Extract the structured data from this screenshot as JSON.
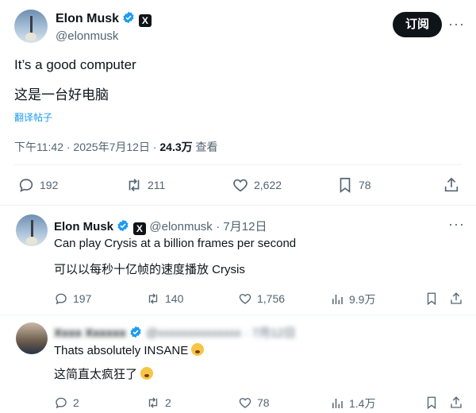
{
  "main_post": {
    "author_name": "Elon Musk",
    "author_handle": "@elonmusk",
    "x_badge": "X",
    "subscribe_label": "订阅",
    "more_label": "···",
    "text_en": "It’s a good computer",
    "text_zh": "这是一台好电脑",
    "translate_label": "翻译帖子",
    "time": "下午11:42 · 2025年7月12日 · ",
    "views": "24.3万",
    "views_label": " 查看",
    "stats": {
      "replies": "192",
      "reposts": "211",
      "likes": "2,622",
      "bookmarks": "78"
    }
  },
  "reply1": {
    "author_name": "Elon Musk",
    "author_handle": "@elonmusk",
    "date": "· 7月12日",
    "more_label": "···",
    "text_en": "Can play Crysis at a billion frames per second",
    "text_zh": "可以以每秒十亿帧的速度播放 Crysis",
    "stats": {
      "replies": "197",
      "reposts": "140",
      "likes": "1,756",
      "views": "9.9万"
    }
  },
  "reply2": {
    "author_name_blurred": "Xxxx Xxxxxx",
    "author_handle_blurred": "@xxxxxxxxxxxxxx",
    "date_blurred": "· 7月12日",
    "text_en": "Thats absolutely INSANE",
    "text_zh": "这简直太疯狂了",
    "stats": {
      "replies": "2",
      "reposts": "2",
      "likes": "78",
      "views": "1.4万"
    }
  },
  "colors": {
    "text": "#0f1419",
    "secondary": "#536471",
    "link": "#1d9bf0",
    "verified": "#1d9bf0",
    "divider": "#eff3f4"
  },
  "icons": [
    "verified-icon",
    "x-logo-icon",
    "reply-icon",
    "repost-icon",
    "like-icon",
    "bookmark-icon",
    "share-icon",
    "views-icon",
    "more-icon"
  ]
}
